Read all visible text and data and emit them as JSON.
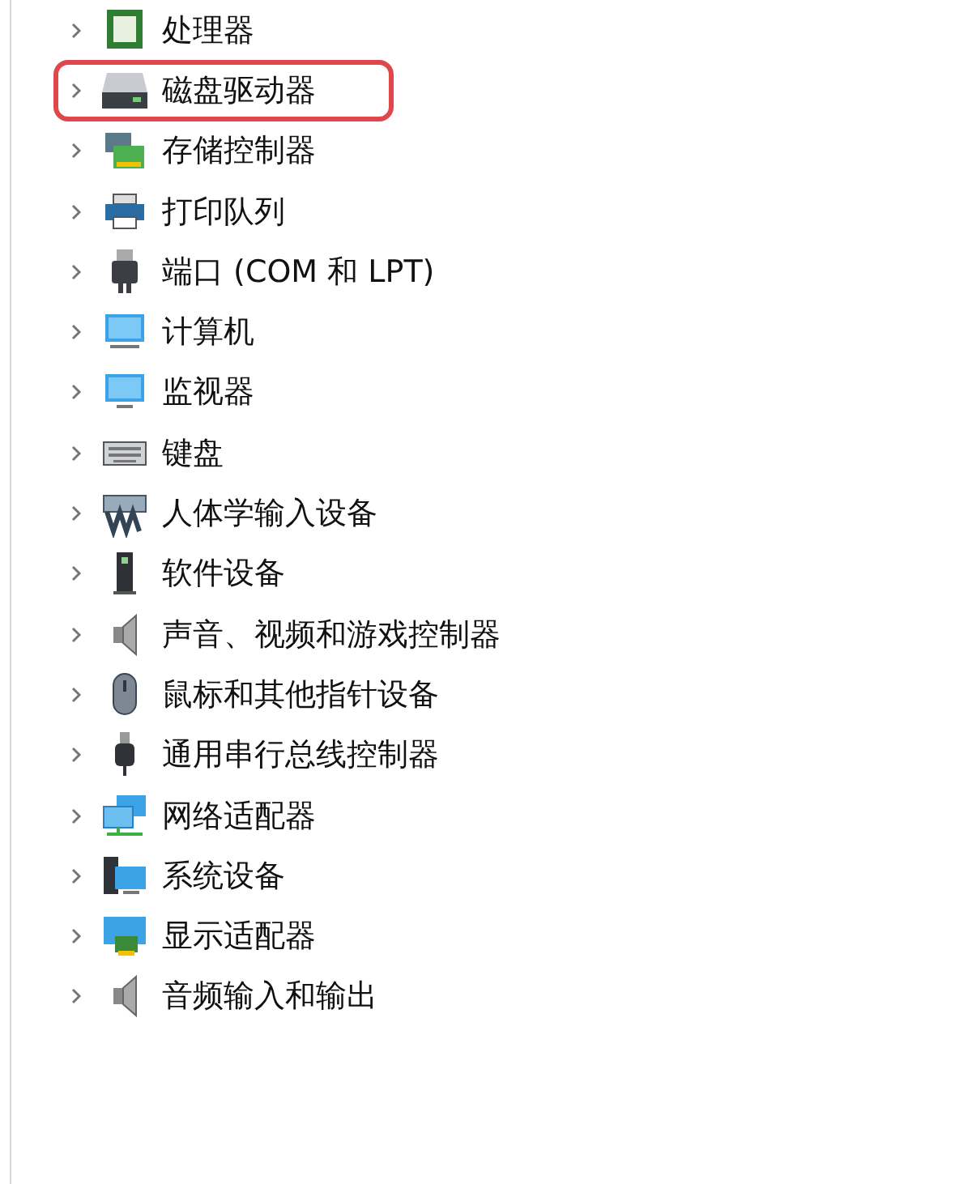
{
  "tree": {
    "items": [
      {
        "label": "处理器",
        "expanded": false,
        "highlighted": false
      },
      {
        "label": "磁盘驱动器",
        "expanded": false,
        "highlighted": true
      },
      {
        "label": "存储控制器",
        "expanded": false,
        "highlighted": false
      },
      {
        "label": "打印队列",
        "expanded": false,
        "highlighted": false
      },
      {
        "label": "端口 (COM 和 LPT)",
        "expanded": false,
        "highlighted": false
      },
      {
        "label": "计算机",
        "expanded": false,
        "highlighted": false
      },
      {
        "label": "监视器",
        "expanded": false,
        "highlighted": false
      },
      {
        "label": "键盘",
        "expanded": false,
        "highlighted": false
      },
      {
        "label": "人体学输入设备",
        "expanded": false,
        "highlighted": false
      },
      {
        "label": "软件设备",
        "expanded": false,
        "highlighted": false
      },
      {
        "label": "声音、视频和游戏控制器",
        "expanded": false,
        "highlighted": false
      },
      {
        "label": "鼠标和其他指针设备",
        "expanded": false,
        "highlighted": false
      },
      {
        "label": "通用串行总线控制器",
        "expanded": false,
        "highlighted": false
      },
      {
        "label": "网络适配器",
        "expanded": false,
        "highlighted": false
      },
      {
        "label": "系统设备",
        "expanded": false,
        "highlighted": false
      },
      {
        "label": "显示适配器",
        "expanded": false,
        "highlighted": false
      },
      {
        "label": "音频输入和输出",
        "expanded": false,
        "highlighted": false
      }
    ]
  }
}
